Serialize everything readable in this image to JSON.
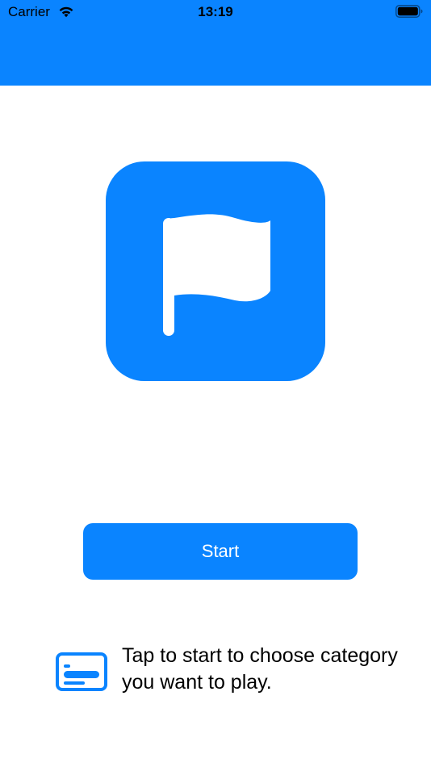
{
  "status_bar": {
    "carrier": "Carrier",
    "time": "13:19",
    "wifi_icon": "wifi-icon",
    "battery_icon": "battery-icon"
  },
  "header": {
    "background_color": "#0A84FF"
  },
  "hero": {
    "icon": "flag-icon",
    "tile_color": "#0A84FF"
  },
  "start_button": {
    "label": "Start",
    "color": "#0A84FF"
  },
  "hint": {
    "icon": "category-card-icon",
    "text": "Tap to start to choose category you want to play."
  }
}
